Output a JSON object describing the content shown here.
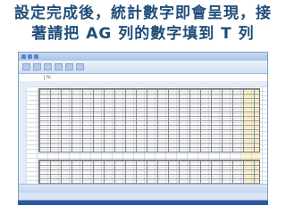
{
  "headline": {
    "line1": "設定完成後，統計數字即會呈現，接",
    "line2": "著請把 AG 列的數字填到 T 列"
  },
  "screenshot": {
    "app": "Microsoft Excel",
    "formula_label": "fx"
  }
}
